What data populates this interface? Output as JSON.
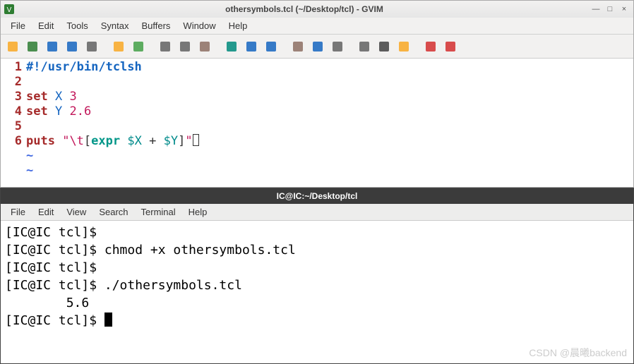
{
  "gvim": {
    "title": "othersymbols.tcl (~/Desktop/tcl) - GVIM",
    "menu": [
      "File",
      "Edit",
      "Tools",
      "Syntax",
      "Buffers",
      "Window",
      "Help"
    ],
    "toolbar_icons": [
      "open-icon",
      "new-icon",
      "save-icon",
      "save-all-icon",
      "print-icon",
      "undo-icon",
      "redo-icon",
      "cut-icon",
      "copy-icon",
      "paste-icon",
      "find-replace-icon",
      "find-next-icon",
      "find-prev-icon",
      "load-session-icon",
      "save-session-icon",
      "run-script-icon",
      "make-icon",
      "shell-icon",
      "tag-jump-icon",
      "help-icon",
      "find-help-icon"
    ],
    "code_lines": [
      {
        "num": "1",
        "tokens": [
          [
            "comment",
            "#!/usr/bin/tclsh"
          ]
        ]
      },
      {
        "num": "2",
        "tokens": []
      },
      {
        "num": "3",
        "tokens": [
          [
            "kw",
            "set"
          ],
          [
            "sp",
            " "
          ],
          [
            "var2",
            "X"
          ],
          [
            "sp",
            " "
          ],
          [
            "num",
            "3"
          ]
        ]
      },
      {
        "num": "4",
        "tokens": [
          [
            "kw",
            "set"
          ],
          [
            "sp",
            " "
          ],
          [
            "var2",
            "Y"
          ],
          [
            "sp",
            " "
          ],
          [
            "num",
            "2.6"
          ]
        ]
      },
      {
        "num": "5",
        "tokens": []
      },
      {
        "num": "6",
        "tokens": [
          [
            "kw",
            "puts"
          ],
          [
            "sp",
            " "
          ],
          [
            "str",
            "\"\\t"
          ],
          [
            "op",
            "["
          ],
          [
            "expr",
            "expr"
          ],
          [
            "sp",
            " "
          ],
          [
            "dollar",
            "$X"
          ],
          [
            "sp",
            " "
          ],
          [
            "op",
            "+"
          ],
          [
            "sp",
            " "
          ],
          [
            "dollar",
            "$Y"
          ],
          [
            "op",
            "]"
          ],
          [
            "str",
            "\""
          ],
          [
            "cursor",
            ""
          ]
        ]
      }
    ],
    "tildes": [
      "~",
      "~"
    ]
  },
  "terminal": {
    "title": "IC@IC:~/Desktop/tcl",
    "menu": [
      "File",
      "Edit",
      "View",
      "Search",
      "Terminal",
      "Help"
    ],
    "prompt": "[IC@IC tcl]$ ",
    "lines": [
      {
        "prompt": true,
        "text": ""
      },
      {
        "prompt": true,
        "text": "chmod +x othersymbols.tcl"
      },
      {
        "prompt": true,
        "text": ""
      },
      {
        "prompt": true,
        "text": "./othersymbols.tcl"
      },
      {
        "prompt": false,
        "text": "        5.6"
      },
      {
        "prompt": true,
        "text": "",
        "cursor": true
      }
    ]
  },
  "watermark": "CSDN @晨曦backend"
}
